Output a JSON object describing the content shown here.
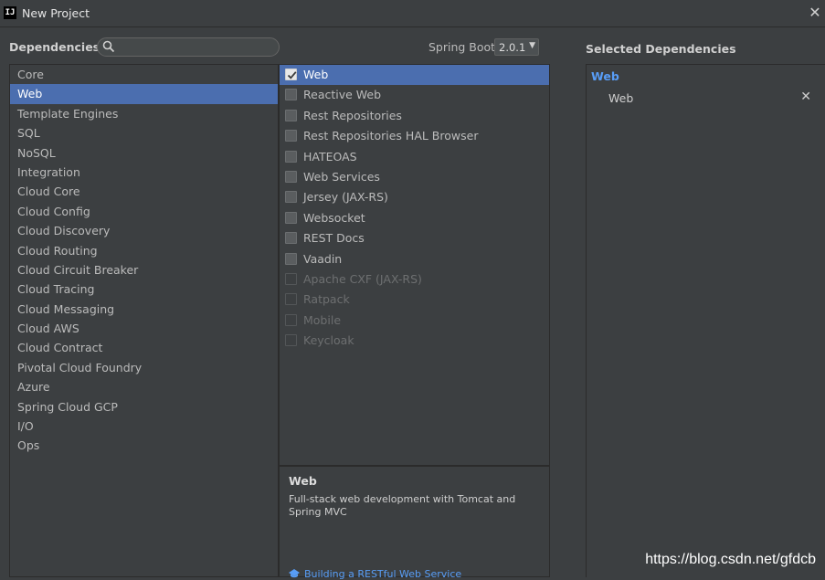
{
  "window": {
    "title": "New Project",
    "close_icon": "close-icon"
  },
  "header": {
    "dependencies_label": "Dependencies",
    "search": {
      "value": "",
      "placeholder": ""
    },
    "spring_boot_label": "Spring Boot",
    "spring_boot_version": "2.0.1"
  },
  "categories": [
    {
      "label": "Core"
    },
    {
      "label": "Web",
      "selected": true
    },
    {
      "label": "Template Engines"
    },
    {
      "label": "SQL"
    },
    {
      "label": "NoSQL"
    },
    {
      "label": "Integration"
    },
    {
      "label": "Cloud Core"
    },
    {
      "label": "Cloud Config"
    },
    {
      "label": "Cloud Discovery"
    },
    {
      "label": "Cloud Routing"
    },
    {
      "label": "Cloud Circuit Breaker"
    },
    {
      "label": "Cloud Tracing"
    },
    {
      "label": "Cloud Messaging"
    },
    {
      "label": "Cloud AWS"
    },
    {
      "label": "Cloud Contract"
    },
    {
      "label": "Pivotal Cloud Foundry"
    },
    {
      "label": "Azure"
    },
    {
      "label": "Spring Cloud GCP"
    },
    {
      "label": "I/O"
    },
    {
      "label": "Ops"
    }
  ],
  "dependencies": [
    {
      "label": "Web",
      "checked": true,
      "selected": true,
      "enabled": true
    },
    {
      "label": "Reactive Web",
      "checked": false,
      "enabled": true
    },
    {
      "label": "Rest Repositories",
      "checked": false,
      "enabled": true
    },
    {
      "label": "Rest Repositories HAL Browser",
      "checked": false,
      "enabled": true
    },
    {
      "label": "HATEOAS",
      "checked": false,
      "enabled": true
    },
    {
      "label": "Web Services",
      "checked": false,
      "enabled": true
    },
    {
      "label": "Jersey (JAX-RS)",
      "checked": false,
      "enabled": true
    },
    {
      "label": "Websocket",
      "checked": false,
      "enabled": true
    },
    {
      "label": "REST Docs",
      "checked": false,
      "enabled": true
    },
    {
      "label": "Vaadin",
      "checked": false,
      "enabled": true
    },
    {
      "label": "Apache CXF (JAX-RS)",
      "checked": false,
      "enabled": false
    },
    {
      "label": "Ratpack",
      "checked": false,
      "enabled": false
    },
    {
      "label": "Mobile",
      "checked": false,
      "enabled": false
    },
    {
      "label": "Keycloak",
      "checked": false,
      "enabled": false
    }
  ],
  "description": {
    "title": "Web",
    "text": "Full-stack web development with Tomcat and Spring MVC",
    "link_text": "Building a RESTful Web Service",
    "link_icon": "guide-icon"
  },
  "selected": {
    "title": "Selected Dependencies",
    "group": "Web",
    "items": [
      {
        "label": "Web",
        "remove_icon": "close-icon"
      }
    ]
  },
  "watermark": "https://blog.csdn.net/gfdcb",
  "colors": {
    "selection": "#4b6eaf",
    "link": "#589df6",
    "background": "#3c3f41"
  }
}
